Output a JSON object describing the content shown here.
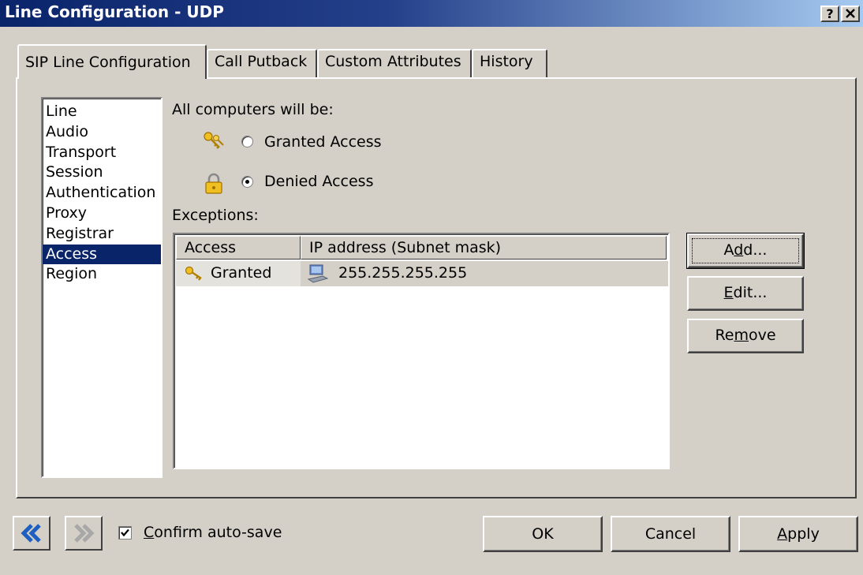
{
  "window": {
    "title": "Line Configuration - UDP",
    "help_glyph": "?",
    "close_glyph": "✕"
  },
  "tabs": [
    {
      "label": "SIP Line Configuration",
      "active": true
    },
    {
      "label": "Call Putback",
      "active": false
    },
    {
      "label": "Custom Attributes",
      "active": false
    },
    {
      "label": "History",
      "active": false
    }
  ],
  "categories": [
    "Line",
    "Audio",
    "Transport",
    "Session",
    "Authentication",
    "Proxy",
    "Registrar",
    "Access",
    "Region"
  ],
  "selected_category": "Access",
  "access": {
    "heading": "All computers will be:",
    "granted_label": "Granted Access",
    "denied_label": "Denied Access",
    "selected": "denied",
    "exceptions_label": "Exceptions:",
    "columns": [
      "Access",
      "IP address (Subnet mask)"
    ],
    "rows": [
      {
        "access": "Granted",
        "ip": "255.255.255.255"
      }
    ]
  },
  "side_buttons": {
    "add": {
      "pre": "A",
      "mnemonic": "d",
      "post": "d..."
    },
    "edit": {
      "pre": "",
      "mnemonic": "E",
      "post": "dit..."
    },
    "remove": {
      "pre": "Re",
      "mnemonic": "m",
      "post": "ove"
    }
  },
  "footer": {
    "confirm_mnemonic": "C",
    "confirm_rest": "onfirm auto-save",
    "confirm_checked": true,
    "ok": "OK",
    "cancel": "Cancel",
    "apply_mnemonic": "A",
    "apply_rest": "pply"
  },
  "colors": {
    "selection": "#0a246a",
    "face": "#d4d0c8",
    "nav_arrow": "#1f5fbf"
  }
}
